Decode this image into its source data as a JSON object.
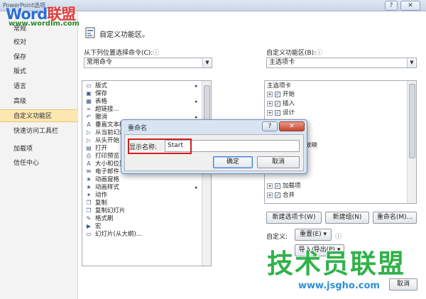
{
  "window": {
    "title": "PowerPoint选项",
    "help": "?",
    "close": "✕"
  },
  "watermark_top": {
    "word_blue": "Word",
    "word_red": "联盟",
    "url": "www.wordlm.com"
  },
  "nav": [
    {
      "label": "常规"
    },
    {
      "label": "校对"
    },
    {
      "label": "保存"
    },
    {
      "label": "版式"
    },
    {
      "label": "语言"
    },
    {
      "label": "高级"
    },
    {
      "label": "自定义功能区"
    },
    {
      "label": "快速访问工具栏"
    },
    {
      "label": "加载项"
    },
    {
      "label": "信任中心"
    }
  ],
  "header": {
    "title": "自定义功能区。"
  },
  "left": {
    "label": "从下列位置选择命令(C):",
    "info": "ⓘ",
    "dropdown_value": "常用命令",
    "commands": [
      {
        "icon": "▭",
        "label": "版式",
        "sub": "▸"
      },
      {
        "icon": "▣",
        "label": "保存",
        "sub": ""
      },
      {
        "icon": "▦",
        "label": "表格",
        "sub": "▸"
      },
      {
        "icon": "∞",
        "label": "超链接...",
        "sub": ""
      },
      {
        "icon": "↶",
        "label": "撤消",
        "sub": "▸"
      },
      {
        "icon": "A",
        "label": "垂直文本框",
        "sub": ""
      },
      {
        "icon": "▷",
        "label": "从当前幻灯片开始",
        "sub": ""
      },
      {
        "icon": "▷",
        "label": "从头开始",
        "sub": ""
      },
      {
        "icon": "▤",
        "label": "打开",
        "sub": ""
      },
      {
        "icon": "⎙",
        "label": "打印预览",
        "sub": ""
      },
      {
        "icon": "A",
        "label": "大小和位置",
        "sub": ""
      },
      {
        "icon": "✉",
        "label": "电子邮件",
        "sub": ""
      },
      {
        "icon": "★",
        "label": "动画窗格",
        "sub": ""
      },
      {
        "icon": "★",
        "label": "动画样式",
        "sub": "▸"
      },
      {
        "icon": "✦",
        "label": "动作",
        "sub": ""
      },
      {
        "icon": "❐",
        "label": "复制",
        "sub": ""
      },
      {
        "icon": "❐",
        "label": "复制幻灯片",
        "sub": ""
      },
      {
        "icon": "✎",
        "label": "格式刷",
        "sub": ""
      },
      {
        "icon": "▶",
        "label": "宏",
        "sub": ""
      },
      {
        "icon": "▭",
        "label": "幻灯片(从大纲)...",
        "sub": ""
      }
    ]
  },
  "right": {
    "label": "自定义功能区(B):",
    "info": "ⓘ",
    "dropdown_value": "主选项卡",
    "tree_header": "主选项卡",
    "tabs": [
      {
        "label": "开始"
      },
      {
        "label": "插入"
      },
      {
        "label": "设计"
      },
      {
        "label": "放映"
      },
      {
        "label": "加载项"
      },
      {
        "label": "合并"
      }
    ],
    "new_tab": "新建选项卡(W)",
    "new_group": "新建组(N)",
    "rename": "重命名(M)...",
    "customize_label": "自定义:",
    "reset": "重置(E) ▾",
    "import_export": "导入/导出(P) ▾",
    "info2": "ⓘ"
  },
  "footer": {
    "cancel": "取消"
  },
  "rename_dialog": {
    "title": "重命名",
    "help": "?",
    "close": "✕",
    "field_label": "显示名称:",
    "field_value": "Start",
    "ok": "确定",
    "cancel": "取消"
  },
  "watermark_bottom": {
    "text": "技术员联盟",
    "url": "www.jsgho.com"
  },
  "colors": {
    "nav_selected": "#fce7b1",
    "highlight_red": "#d01f1f",
    "close_red": "#c8442c",
    "watermark_green": "#31b24a"
  }
}
